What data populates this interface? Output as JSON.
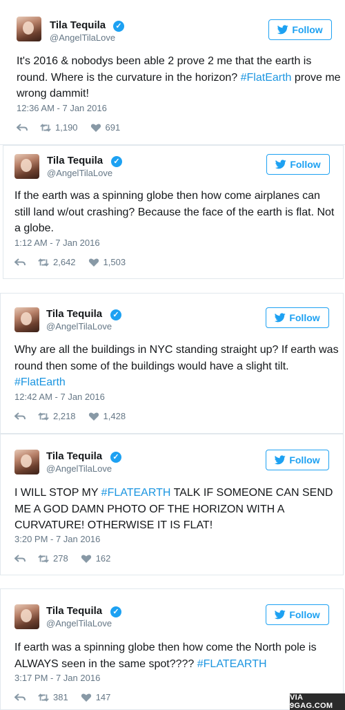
{
  "colors": {
    "accent": "#1da1f2",
    "hashtag": "#1b95e0",
    "muted": "#657786"
  },
  "tweets": [
    {
      "name": "Tila Tequila",
      "handle": "@AngelTilaLove",
      "follow_label": "Follow",
      "text_parts": [
        "It's 2016 & nobodys been able 2 prove 2 me that the earth is round. Where is the curvature in the horizon? ",
        "#FlatEarth",
        " prove me wrong dammit!"
      ],
      "timestamp": "12:36 AM - 7 Jan 2016",
      "retweets": "1,190",
      "likes": "691"
    },
    {
      "name": "Tila Tequila",
      "handle": "@AngelTilaLove",
      "follow_label": "Follow",
      "text_parts": [
        "If the earth was a spinning globe then how come airplanes can still land w/out crashing? Because the face of the earth is flat. Not a globe."
      ],
      "timestamp": "1:12 AM - 7 Jan 2016",
      "retweets": "2,642",
      "likes": "1,503"
    },
    {
      "name": "Tila Tequila",
      "handle": "@AngelTilaLove",
      "follow_label": "Follow",
      "text_parts": [
        "Why are all the buildings in NYC standing straight up? If earth was round then some of the buildings would have a slight tilt. ",
        "#FlatEarth",
        ""
      ],
      "timestamp": "12:42 AM - 7 Jan 2016",
      "retweets": "2,218",
      "likes": "1,428"
    },
    {
      "name": "Tila Tequila",
      "handle": "@AngelTilaLove",
      "follow_label": "Follow",
      "text_parts": [
        "I WILL STOP MY ",
        "#FLATEARTH",
        " TALK IF SOMEONE CAN SEND ME A GOD DAMN PHOTO OF THE HORIZON WITH A CURVATURE! OTHERWISE IT IS FLAT!"
      ],
      "timestamp": "3:20 PM - 7 Jan 2016",
      "retweets": "278",
      "likes": "162"
    },
    {
      "name": "Tila Tequila",
      "handle": "@AngelTilaLove",
      "follow_label": "Follow",
      "text_parts": [
        "If earth was a spinning globe then how come the North pole is ALWAYS seen in the same spot???? ",
        "#FLATEARTH",
        ""
      ],
      "timestamp": "3:17 PM - 7 Jan 2016",
      "retweets": "381",
      "likes": "147"
    }
  ],
  "watermark": "VIA 9GAG.COM"
}
